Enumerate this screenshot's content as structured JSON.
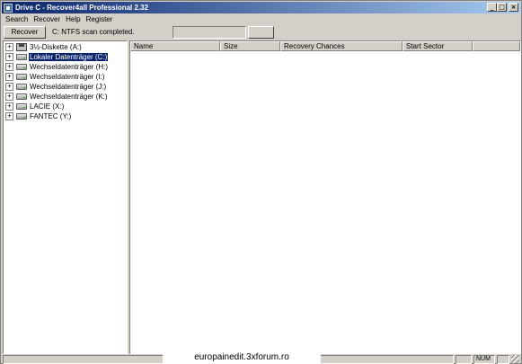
{
  "window": {
    "title": "Drive C  - Recover4all Professional 2.32",
    "minimize_label": "_",
    "maximize_label": "□",
    "close_label": "×"
  },
  "menu": [
    "Search",
    "Recover",
    "Help",
    "Register"
  ],
  "toolbar": {
    "recover_label": "Recover",
    "status": "C: NTFS scan completed.",
    "progress_fraction": 0
  },
  "tree": {
    "expander_glyph": "+",
    "items": [
      {
        "label": "3½-Diskette (A:)",
        "icon": "floppy-icon",
        "selected": false
      },
      {
        "label": "Lokaler Datenträger (C:)",
        "icon": "drive-icon",
        "selected": true
      },
      {
        "label": "Wechseldatenträger (H:)",
        "icon": "drive-icon",
        "selected": false
      },
      {
        "label": "Wechseldatenträger (I:)",
        "icon": "drive-icon",
        "selected": false
      },
      {
        "label": "Wechseldatenträger (J:)",
        "icon": "drive-icon",
        "selected": false
      },
      {
        "label": "Wechseldatenträger (K:)",
        "icon": "drive-icon",
        "selected": false
      },
      {
        "label": "LACIE (X:)",
        "icon": "drive-icon",
        "selected": false
      },
      {
        "label": "FANTEC (Y:)",
        "icon": "drive-icon",
        "selected": false
      }
    ]
  },
  "list": {
    "columns": [
      "Name",
      "Size",
      "Recovery Chances",
      "Start Sector"
    ]
  },
  "statusbar": {
    "num_label": "NUM"
  },
  "watermark": "europainedit.3xforum.ro",
  "colors": {
    "titlebar_start": "#0a246a",
    "titlebar_end": "#a6caf0",
    "selection": "#0a246a",
    "face": "#d4d0c8"
  }
}
